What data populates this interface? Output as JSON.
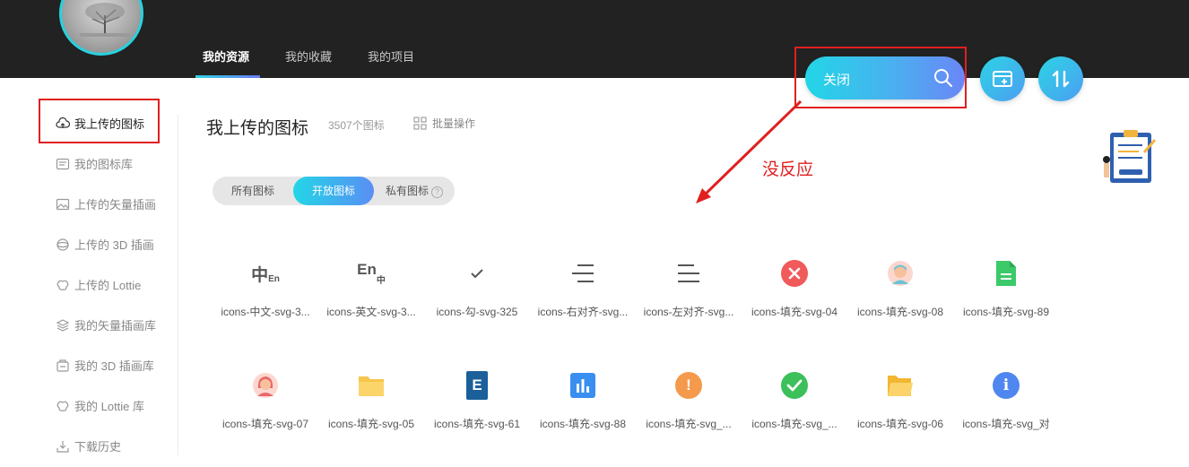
{
  "header": {
    "tabs": [
      {
        "label": "我的资源"
      },
      {
        "label": "我的收藏"
      },
      {
        "label": "我的项目"
      }
    ],
    "search": {
      "label": "关闭"
    }
  },
  "sidebar": {
    "items": [
      {
        "label": "我上传的图标",
        "icon": "cloud-upload-icon"
      },
      {
        "label": "我的图标库",
        "icon": "library-icon"
      },
      {
        "label": "上传的矢量插画",
        "icon": "image-icon"
      },
      {
        "label": "上传的 3D 插画",
        "icon": "sphere-3d-icon"
      },
      {
        "label": "上传的 Lottie",
        "icon": "lottie-icon"
      },
      {
        "label": "我的矢量插画库",
        "icon": "layers-icon"
      },
      {
        "label": "我的 3D 插画库",
        "icon": "box-3d-icon"
      },
      {
        "label": "我的 Lottie 库",
        "icon": "lottie-icon"
      },
      {
        "label": "下载历史",
        "icon": "download-icon"
      }
    ]
  },
  "main": {
    "title": "我上传的图标",
    "count": "3507个图标",
    "batch_label": "批量操作",
    "filters": [
      {
        "label": "所有图标"
      },
      {
        "label": "开放图标"
      },
      {
        "label": "私有图标"
      }
    ],
    "help_glyph": "?"
  },
  "annotation": {
    "text": "没反应"
  },
  "icons": [
    {
      "name": "icons-中文-svg-3...",
      "icon": "chinese-lang-icon",
      "glyph": "中",
      "glyph_sub": "En"
    },
    {
      "name": "icons-英文-svg-3...",
      "icon": "english-lang-icon",
      "glyph": "En",
      "glyph_sub": "中"
    },
    {
      "name": "icons-勾-svg-325",
      "icon": "check-icon"
    },
    {
      "name": "icons-右对齐-svg...",
      "icon": "align-right-icon"
    },
    {
      "name": "icons-左对齐-svg...",
      "icon": "align-left-icon"
    },
    {
      "name": "icons-填充-svg-04",
      "icon": "close-circle-icon"
    },
    {
      "name": "icons-填充-svg-08",
      "icon": "avatar-boy-icon"
    },
    {
      "name": "icons-填充-svg-89",
      "icon": "document-green-icon"
    },
    {
      "name": "icons-填充-svg-07",
      "icon": "avatar-girl-icon"
    },
    {
      "name": "icons-填充-svg-05",
      "icon": "folder-icon"
    },
    {
      "name": "icons-填充-svg-61",
      "icon": "file-e-icon",
      "glyph": "E"
    },
    {
      "name": "icons-填充-svg-88",
      "icon": "bar-chart-icon"
    },
    {
      "name": "icons-填充-svg_...",
      "icon": "warning-circle-icon",
      "glyph": "!"
    },
    {
      "name": "icons-填充-svg_...",
      "icon": "check-circle-icon"
    },
    {
      "name": "icons-填充-svg-06",
      "icon": "folder-open-icon"
    },
    {
      "name": "icons-填充-svg_对",
      "icon": "info-circle-icon",
      "glyph": "i"
    }
  ],
  "colors": {
    "accent_start": "#22d6e6",
    "accent_end": "#6b86f6",
    "annotation_red": "#e02020",
    "header_bg": "#222222"
  }
}
